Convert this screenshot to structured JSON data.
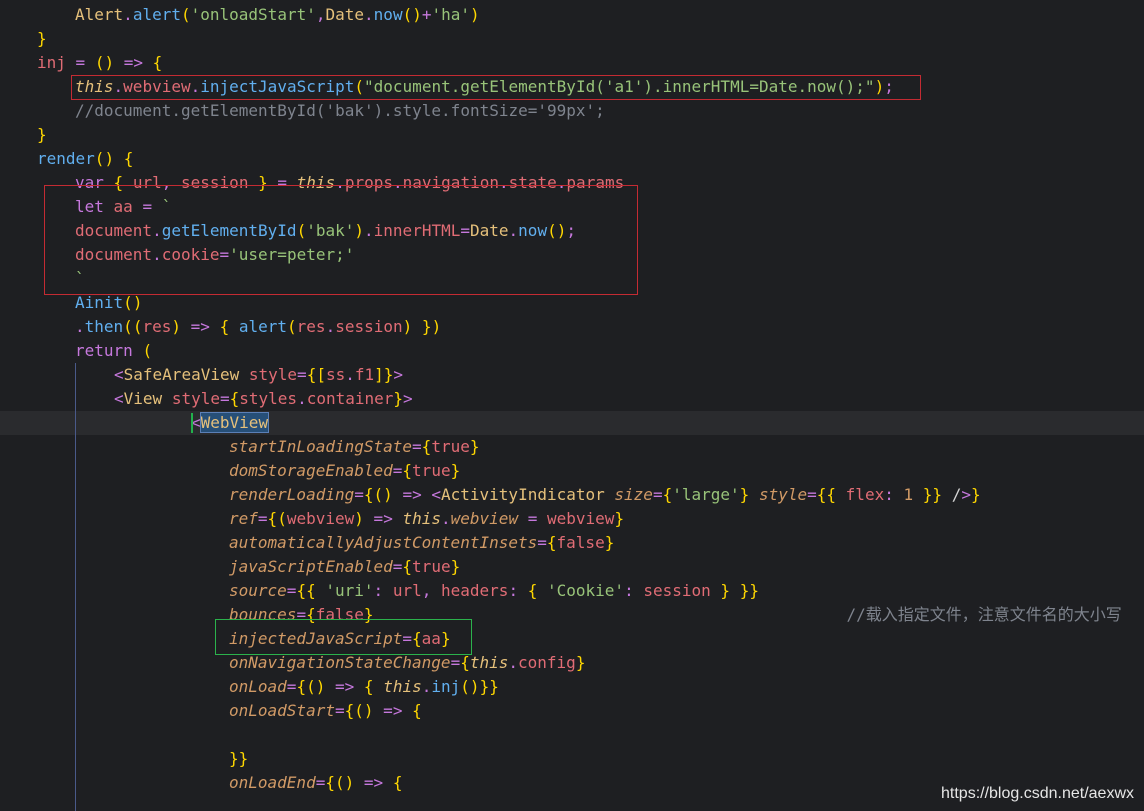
{
  "lines": [
    "Alert.alert('onloadStart',Date.now()+'ha')",
    "}",
    "inj = () => {",
    "this.webview.injectJavaScript(\"document.getElementById('a1').innerHTML=Date.now();\");",
    "//document.getElementById('bak').style.fontSize='99px';",
    "}",
    "render() {",
    "var { url, session } = this.props.navigation.state.params",
    "let aa = `",
    "document.getElementById('bak').innerHTML=Date.now();",
    "document.cookie='user=peter;'",
    "`",
    "Ainit()",
    ".then((res) => { alert(res.session) })",
    "return (",
    "<SafeAreaView style={[ss.f1]}>",
    "<View style={styles.container}>",
    "<WebView",
    "startInLoadingState={true}",
    "domStorageEnabled={true}",
    "renderLoading={() => <ActivityIndicator size={'large'} style={{ flex: 1 }} />}",
    "ref={(webview) => this.webview = webview}",
    "automaticallyAdjustContentInsets={false}",
    "javaScriptEnabled={true}",
    "source={{ 'uri': url, headers: { 'Cookie': session } }}",
    "bounces={false}",
    "injectedJavaScript={aa}",
    "onNavigationStateChange={this.config}",
    "onLoad={() => { this.inj()}}",
    "onLoadStart={() => {",
    "",
    "}}",
    "onLoadEnd={() => {"
  ],
  "inline_comment": "//载入指定文件，注意文件名的大小写",
  "watermark": "https://blog.csdn.net/aexwx",
  "colors": {
    "background": "#1e1f22",
    "keyword": "#c678dd",
    "function": "#61afef",
    "string": "#98c379",
    "variable": "#e06c75",
    "comment": "#7f848e",
    "attribute": "#d19a66",
    "highlight_red": "#c42b33",
    "highlight_green": "#2bb24c"
  }
}
